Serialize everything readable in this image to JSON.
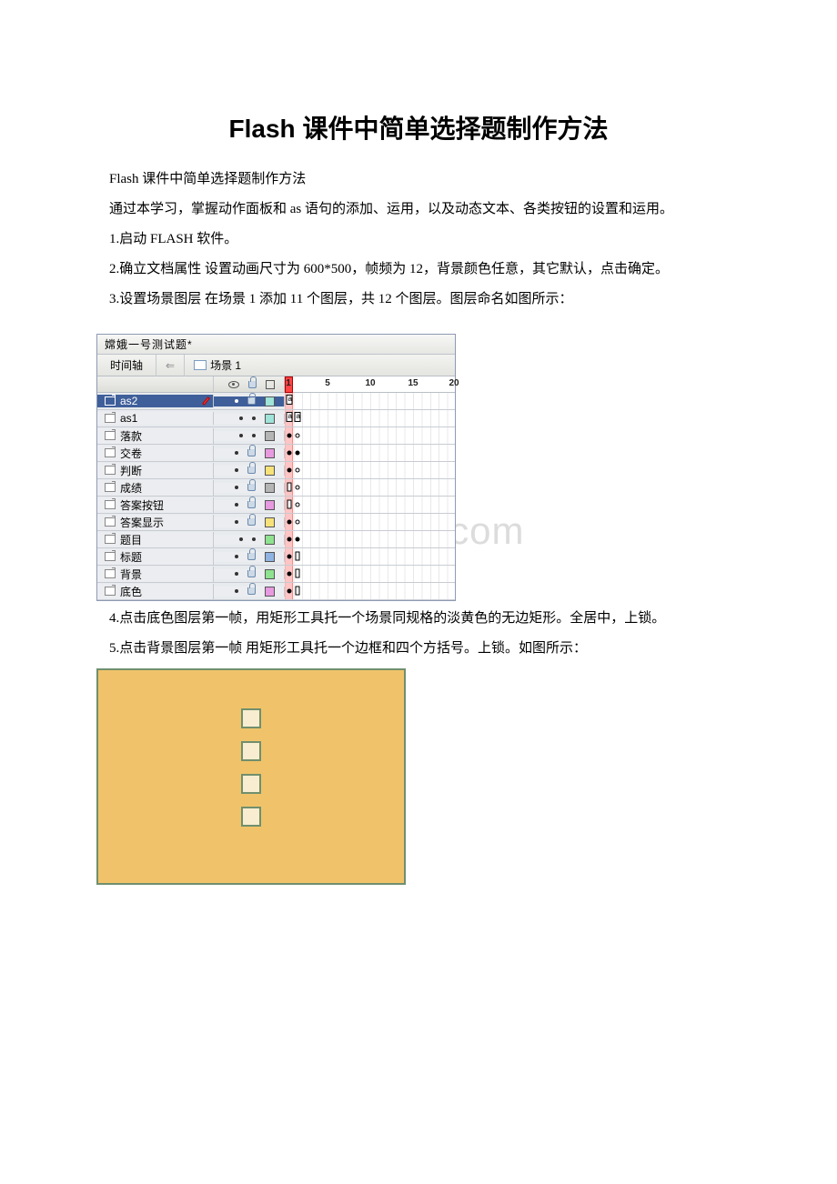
{
  "watermark": "www.bdocx.com",
  "title": "Flash 课件中简单选择题制作方法",
  "p1": "Flash 课件中简单选择题制作方法",
  "p2": "通过本学习，掌握动作面板和 as 语句的添加、运用，以及动态文本、各类按钮的设置和运用。",
  "p3": "1.启动 FLASH 软件。",
  "p4": "2.确立文档属性 设置动画尺寸为 600*500，帧频为 12，背景颜色任意，其它默认，点击确定。",
  "p5": "3.设置场景图层 在场景 1 添加 11 个图层，共 12 个图层。图层命名如图所示：",
  "p6": "4.点击底色图层第一帧，用矩形工具托一个场景同规格的淡黄色的无边矩形。全居中，上锁。",
  "p7": "5.点击背景图层第一帧 用矩形工具托一个边框和四个方括号。上锁。如图所示：",
  "timeline": {
    "window_title": "嫦娥一号测试题*",
    "tab_timeline": "时间轴",
    "arrow": "⇐",
    "scene": "场景 1",
    "ruler": [
      "1",
      "5",
      "10",
      "15",
      "20"
    ],
    "layers": [
      {
        "name": "as2",
        "locked": true,
        "swatch": "#9fe3d9",
        "selected": true,
        "kf": "script1"
      },
      {
        "name": "as1",
        "locked": false,
        "swatch": "#9fe3d9",
        "selected": false,
        "kf": "script2"
      },
      {
        "name": "落款",
        "locked": false,
        "swatch": "#b5b5b5",
        "selected": false,
        "kf": "dot-hollow"
      },
      {
        "name": "交卷",
        "locked": true,
        "swatch": "#e79ae0",
        "selected": false,
        "kf": "dot-span"
      },
      {
        "name": "判断",
        "locked": true,
        "swatch": "#f7e27a",
        "selected": false,
        "kf": "dot-hollow"
      },
      {
        "name": "成绩",
        "locked": true,
        "swatch": "#b5b5b5",
        "selected": false,
        "kf": "rect"
      },
      {
        "name": "答案按钮",
        "locked": true,
        "swatch": "#e79ae0",
        "selected": false,
        "kf": "rect"
      },
      {
        "name": "答案显示",
        "locked": true,
        "swatch": "#f7e27a",
        "selected": false,
        "kf": "dot-hollow"
      },
      {
        "name": "题目",
        "locked": false,
        "swatch": "#8fe28f",
        "selected": false,
        "kf": "two-dots"
      },
      {
        "name": "标题",
        "locked": true,
        "swatch": "#8fb3e2",
        "selected": false,
        "kf": "dot-rect"
      },
      {
        "name": "背景",
        "locked": true,
        "swatch": "#8fe28f",
        "selected": false,
        "kf": "dot-rect"
      },
      {
        "name": "底色",
        "locked": true,
        "swatch": "#e79ae0",
        "selected": false,
        "kf": "dot-rect"
      }
    ]
  }
}
